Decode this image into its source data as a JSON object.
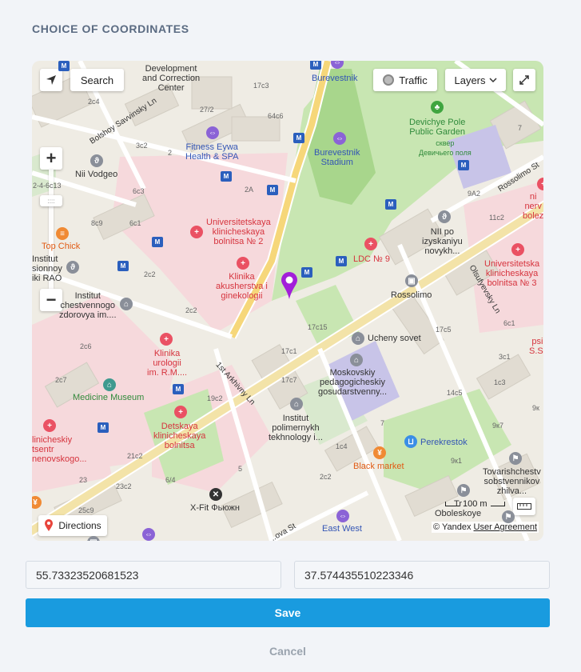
{
  "page": {
    "title": "CHOICE OF COORDINATES"
  },
  "map": {
    "controls": {
      "search_label": "Search",
      "traffic_label": "Traffic",
      "layers_label": "Layers",
      "directions_label": "Directions",
      "scale_label": "100 m",
      "copyright": "© Yandex",
      "user_agreement": "User Agreement"
    },
    "labels": {
      "development": "Development\nand Correction\nCenter",
      "burevestnik": "Burevestnik",
      "burevestnik_stadium": "Burevestnik\nStadium",
      "devichye_pole": "Devichye Pole\nPublic Garden",
      "skver": "сквер\nДевичьего поля",
      "fitness": "Fitness Eywa\nHealth & SPA",
      "nii_vodgeo": "Nii Vodgeo",
      "bolshoy": "Bolshoy Savvinsky Ln",
      "top_chick": "Top Chick",
      "institut_left": "Institut\nsionnoy\niki RAO",
      "univ_hosp_2": "Universitetskaya\nklinicheskaya\nbolnitsa № 2",
      "klinika_akush": "Klinika\nakusherstva i\nginekologii",
      "institut_zdorovya": "Institut\nchestvennogo\nzdorovya im....",
      "nii_po": "NII po\nizyskaniyu\nnovykh...",
      "ldc9": "LDC № 9",
      "rossolimo": "Rossolimo",
      "rossolimo_st": "Rossolimo St",
      "univ_hosp_3": "Universitetska\nklinicheskaya\nbolnitsa № 3",
      "nerv": "ni\nnerv\nbolez",
      "olsufyevsky": "Olsufyevsky Ln",
      "klinika_urologii": "Klinika\nurologii\nim. R.M....",
      "ucheny_sovet": "Ucheny sovet",
      "moskovskiy": "Moskovskiy\npedagogicheskiy\ngosudarstvenny...",
      "medicine_museum": "Medicine Museum",
      "arkhivny": "1st Arkhivny Ln",
      "detskaya": "Detskaya\nklinicheskaya\nbolnitsa",
      "institut_polimer": "Institut\npolimernykh\ntekhnology i...",
      "klinich_left": "linicheskiy\ntsentr\nnenovskogo...",
      "perekrestok": "Perekrestok",
      "black_market": "Black market",
      "tovarishch": "Tovarishchestv\nsobstvennikov\nzhilva...",
      "oboleskoye": "Tr\nOboleskoye",
      "xfit": "X-Fit Фьюжн",
      "east_west": "East West",
      "psi": "psi\nS.S.",
      "n_17c3": "17с3",
      "n_27_2": "27/2",
      "n_64c6": "64с6",
      "n_2c4": "2с4",
      "n_3c2": "3с2",
      "n_2": "2",
      "n_6c3": "6с3",
      "n_2A": "2А",
      "n_2413": "2-4-6с13",
      "n_8c9": "8с9",
      "n_6c1": "6с1",
      "n_2c2": "2с2",
      "n_2c2b": "2с2",
      "n_2c6": "2с6",
      "n_2c7": "2с7",
      "n_17c15": "17с15",
      "n_17c1": "17с1",
      "n_17c7": "17с7",
      "n_19c2": "19с2",
      "n_21c2": "21с2",
      "n_23": "23",
      "n_23c2": "23с2",
      "n_6_4": "6/4",
      "n_25c9": "25с9",
      "n_5": "5",
      "n_2c2c": "2с2",
      "n_7": "7",
      "n_1c4": "1с4",
      "n_7r": "7",
      "n_9A2": "9А2",
      "n_11c2": "11с2",
      "n_17c5": "17с5",
      "n_6c1b": "6с1",
      "n_3c1": "3с1",
      "n_1c3": "1с3",
      "n_14c5": "14с5",
      "n_9k7": "9к7",
      "n_9k1": "9к1",
      "n_9k": "9к",
      "n_va_st": "..ova St"
    }
  },
  "form": {
    "latitude": "55.73323520681523",
    "longitude": "37.574435510223346",
    "save_label": "Save",
    "cancel_label": "Cancel"
  },
  "colors": {
    "accent": "#199bdf",
    "pin": "#a21fd9"
  }
}
